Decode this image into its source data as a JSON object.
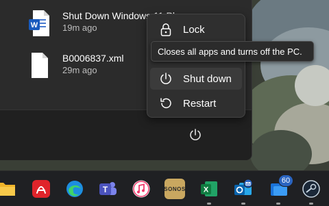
{
  "recent_files": [
    {
      "name": "Shut Down Windows 11 Pl",
      "time": "19m ago",
      "icon": "word-document-icon"
    },
    {
      "name": "B0006837.xml",
      "time": "29m ago",
      "icon": "xml-file-icon"
    }
  ],
  "power_menu": {
    "items": [
      {
        "label": "Lock",
        "icon": "lock-icon"
      },
      {
        "label": "Shut down",
        "icon": "power-icon"
      },
      {
        "label": "Restart",
        "icon": "restart-icon"
      }
    ],
    "tooltip": "Closes all apps and turns off the PC."
  },
  "taskbar": {
    "apps": [
      {
        "name": "File Explorer",
        "icon": "folder-icon"
      },
      {
        "name": "Adobe Acrobat",
        "icon": "acrobat-icon"
      },
      {
        "name": "Microsoft Edge",
        "icon": "edge-icon"
      },
      {
        "name": "Microsoft Teams",
        "icon": "teams-icon"
      },
      {
        "name": "iTunes",
        "icon": "itunes-icon"
      },
      {
        "name": "Sonos",
        "icon": "sonos-icon",
        "label": "SONOS"
      },
      {
        "name": "Excel",
        "icon": "excel-icon"
      },
      {
        "name": "Outlook",
        "icon": "outlook-icon"
      },
      {
        "name": "Mail",
        "icon": "mail-icon",
        "badge": "60"
      },
      {
        "name": "Steam",
        "icon": "steam-icon"
      }
    ]
  },
  "colors": {
    "menu_bg": "#2f2f2f",
    "taskbar_bg": "#1f2023",
    "word_blue": "#185abd",
    "excel_green": "#107c41",
    "badge_blue": "#2a64c0"
  }
}
